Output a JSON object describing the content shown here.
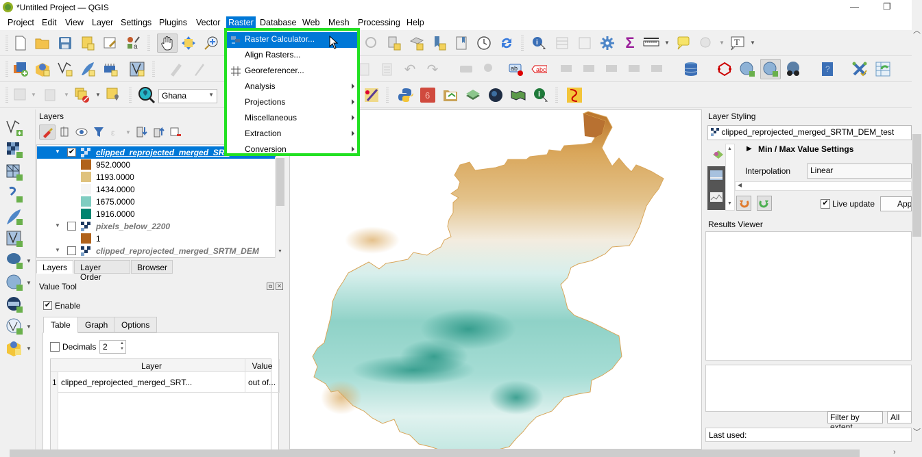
{
  "window": {
    "title": "*Untitled Project — QGIS",
    "minimize": "—",
    "restore": "❐"
  },
  "menubar": {
    "items": [
      "Project",
      "Edit",
      "View",
      "Layer",
      "Settings",
      "Plugins",
      "Vector",
      "Raster",
      "Database",
      "Web",
      "Mesh",
      "Processing",
      "Help"
    ],
    "active": "Raster"
  },
  "raster_menu": {
    "items": [
      {
        "label": "Raster Calculator...",
        "highlighted": true,
        "submenu": false,
        "icon": "raster-calculator-icon"
      },
      {
        "label": "Align Rasters...",
        "highlighted": false,
        "submenu": false
      },
      {
        "label": "Georeferencer...",
        "highlighted": false,
        "submenu": false,
        "icon": "georeferencer-icon"
      },
      {
        "label": "Analysis",
        "highlighted": false,
        "submenu": true
      },
      {
        "label": "Projections",
        "highlighted": false,
        "submenu": true
      },
      {
        "label": "Miscellaneous",
        "highlighted": false,
        "submenu": true
      },
      {
        "label": "Extraction",
        "highlighted": false,
        "submenu": true
      },
      {
        "label": "Conversion",
        "highlighted": false,
        "submenu": true
      }
    ],
    "highlight_color": "#22e022"
  },
  "locator": {
    "value": "Ghana"
  },
  "layers_panel": {
    "title": "Layers",
    "layers": [
      {
        "name": "clipped_reprojected_merged_SRTM_DEM_test",
        "display": "clipped_reprojected_merged_SRT",
        "checked": true,
        "selected": true,
        "legend": [
          {
            "value": "952.0000",
            "color": "#b0621b"
          },
          {
            "value": "1193.0000",
            "color": "#dfc27d"
          },
          {
            "value": "1434.0000",
            "color": "#f5f5f5"
          },
          {
            "value": "1675.0000",
            "color": "#80cdc1"
          },
          {
            "value": "1916.0000",
            "color": "#018571"
          }
        ]
      },
      {
        "name": "pixels_below_2200",
        "checked": false,
        "selected": false,
        "legend": [
          {
            "value": "1",
            "color": "#b0621b"
          }
        ]
      },
      {
        "name": "clipped_reprojected_merged_SRTM_DEM",
        "checked": false,
        "selected": false,
        "legend": []
      }
    ],
    "tabs": [
      "Layers",
      "Layer Order",
      "Browser"
    ],
    "active_tab": "Layers"
  },
  "value_tool": {
    "title": "Value Tool",
    "enable_label": "Enable",
    "enabled": true,
    "tabs": [
      "Table",
      "Graph",
      "Options"
    ],
    "active_tab": "Table",
    "decimals_label": "Decimals",
    "decimals_checked": false,
    "decimals_value": "2",
    "columns": [
      "Layer",
      "Value"
    ],
    "rows": [
      {
        "index": "1",
        "layer": "clipped_reprojected_merged_SRT...",
        "value": "out of..."
      }
    ]
  },
  "layer_styling": {
    "title": "Layer Styling",
    "layer": "clipped_reprojected_merged_SRTM_DEM_test",
    "section": "Min / Max Value Settings",
    "interpolation_label": "Interpolation",
    "interpolation_value": "Linear",
    "live_update_label": "Live update",
    "live_update": true,
    "apply_label": "Apply",
    "apply_display": "App"
  },
  "results_viewer": {
    "title": "Results Viewer",
    "filter_label": "Filter by extent",
    "filter_value": "All",
    "last_used_label": "Last used:"
  }
}
